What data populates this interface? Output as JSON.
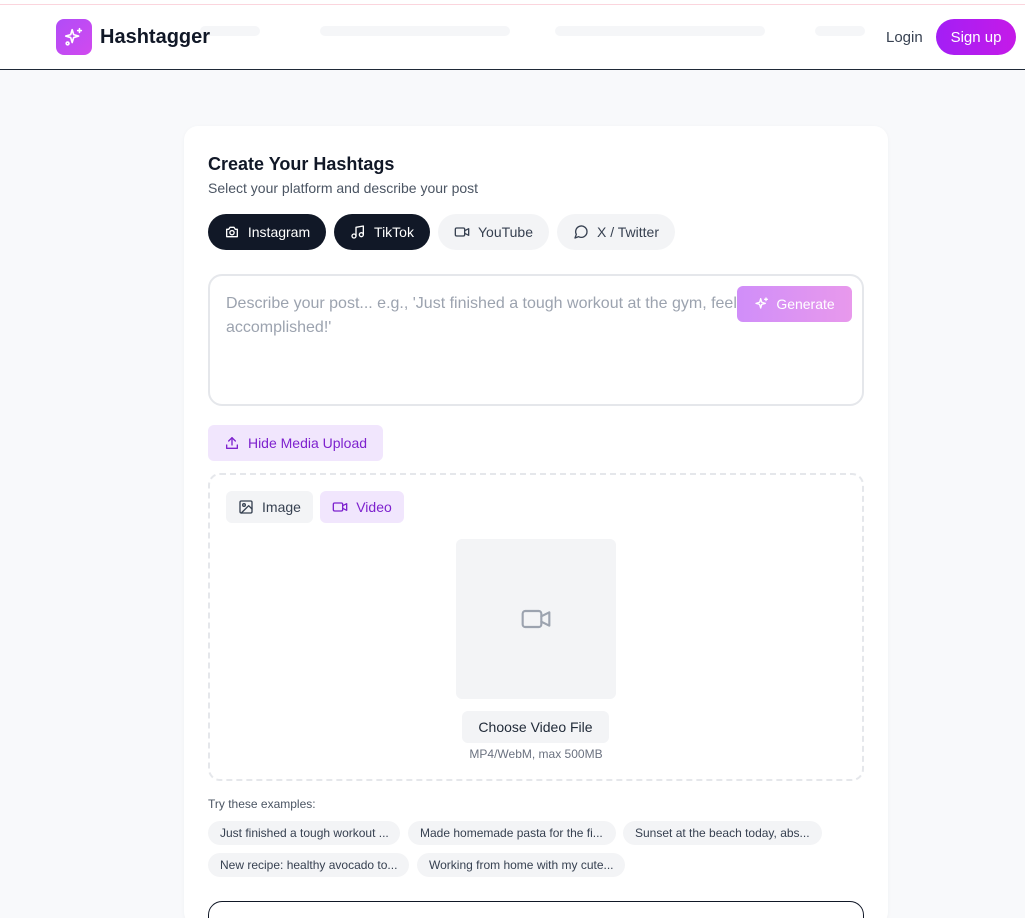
{
  "header": {
    "brand": "Hashtagger",
    "login_label": "Login",
    "signup_label": "Sign up"
  },
  "generator": {
    "title": "Create Your Hashtags",
    "subtitle": "Select your platform and describe your post",
    "platforms": [
      {
        "label": "Instagram",
        "icon": "camera-icon",
        "active": true
      },
      {
        "label": "TikTok",
        "icon": "music-note-icon",
        "active": true
      },
      {
        "label": "YouTube",
        "icon": "video-camera-icon",
        "active": false
      },
      {
        "label": "X / Twitter",
        "icon": "chat-bubble-icon",
        "active": false
      }
    ],
    "post_input": {
      "placeholder_line1": "Describe your post... e.g., 'Just finished a tough workout at the gym, feeling",
      "placeholder_line2": "accomplished!'",
      "value": ""
    },
    "generate_label": "Generate",
    "hide_media_label": "Hide Media Upload",
    "media": {
      "tabs": [
        {
          "label": "Image",
          "icon": "image-icon",
          "selected": false
        },
        {
          "label": "Video",
          "icon": "video-camera-icon",
          "selected": true
        }
      ],
      "choose_label": "Choose Video File",
      "hint": "MP4/WebM, max 500MB"
    },
    "examples": {
      "label": "Try these examples:",
      "items": [
        "Just finished a tough workout ...",
        "Made homemade pasta for the fi...",
        "Sunset at the beach today, abs...",
        "New recipe: healthy avocado to...",
        "Working from home with my cute..."
      ]
    }
  },
  "colors": {
    "brand_gradient_start": "#b14cf7",
    "brand_gradient_end": "#d14aef",
    "signup": "#a31ff5",
    "accent_text": "#7e22ce",
    "active_pill": "#111827"
  }
}
